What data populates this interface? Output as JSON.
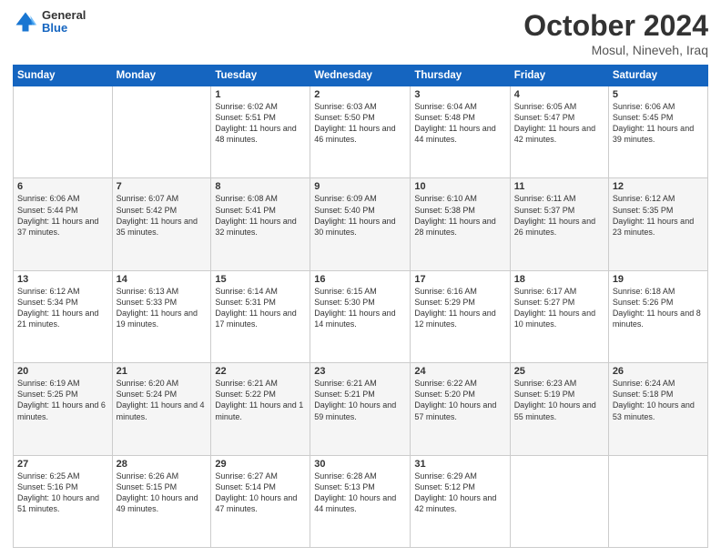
{
  "header": {
    "logo": {
      "general": "General",
      "blue": "Blue"
    },
    "title": "October 2024",
    "location": "Mosul, Nineveh, Iraq"
  },
  "calendar": {
    "headers": [
      "Sunday",
      "Monday",
      "Tuesday",
      "Wednesday",
      "Thursday",
      "Friday",
      "Saturday"
    ],
    "weeks": [
      [
        {
          "day": "",
          "info": ""
        },
        {
          "day": "",
          "info": ""
        },
        {
          "day": "1",
          "info": "Sunrise: 6:02 AM\nSunset: 5:51 PM\nDaylight: 11 hours and 48 minutes."
        },
        {
          "day": "2",
          "info": "Sunrise: 6:03 AM\nSunset: 5:50 PM\nDaylight: 11 hours and 46 minutes."
        },
        {
          "day": "3",
          "info": "Sunrise: 6:04 AM\nSunset: 5:48 PM\nDaylight: 11 hours and 44 minutes."
        },
        {
          "day": "4",
          "info": "Sunrise: 6:05 AM\nSunset: 5:47 PM\nDaylight: 11 hours and 42 minutes."
        },
        {
          "day": "5",
          "info": "Sunrise: 6:06 AM\nSunset: 5:45 PM\nDaylight: 11 hours and 39 minutes."
        }
      ],
      [
        {
          "day": "6",
          "info": "Sunrise: 6:06 AM\nSunset: 5:44 PM\nDaylight: 11 hours and 37 minutes."
        },
        {
          "day": "7",
          "info": "Sunrise: 6:07 AM\nSunset: 5:42 PM\nDaylight: 11 hours and 35 minutes."
        },
        {
          "day": "8",
          "info": "Sunrise: 6:08 AM\nSunset: 5:41 PM\nDaylight: 11 hours and 32 minutes."
        },
        {
          "day": "9",
          "info": "Sunrise: 6:09 AM\nSunset: 5:40 PM\nDaylight: 11 hours and 30 minutes."
        },
        {
          "day": "10",
          "info": "Sunrise: 6:10 AM\nSunset: 5:38 PM\nDaylight: 11 hours and 28 minutes."
        },
        {
          "day": "11",
          "info": "Sunrise: 6:11 AM\nSunset: 5:37 PM\nDaylight: 11 hours and 26 minutes."
        },
        {
          "day": "12",
          "info": "Sunrise: 6:12 AM\nSunset: 5:35 PM\nDaylight: 11 hours and 23 minutes."
        }
      ],
      [
        {
          "day": "13",
          "info": "Sunrise: 6:12 AM\nSunset: 5:34 PM\nDaylight: 11 hours and 21 minutes."
        },
        {
          "day": "14",
          "info": "Sunrise: 6:13 AM\nSunset: 5:33 PM\nDaylight: 11 hours and 19 minutes."
        },
        {
          "day": "15",
          "info": "Sunrise: 6:14 AM\nSunset: 5:31 PM\nDaylight: 11 hours and 17 minutes."
        },
        {
          "day": "16",
          "info": "Sunrise: 6:15 AM\nSunset: 5:30 PM\nDaylight: 11 hours and 14 minutes."
        },
        {
          "day": "17",
          "info": "Sunrise: 6:16 AM\nSunset: 5:29 PM\nDaylight: 11 hours and 12 minutes."
        },
        {
          "day": "18",
          "info": "Sunrise: 6:17 AM\nSunset: 5:27 PM\nDaylight: 11 hours and 10 minutes."
        },
        {
          "day": "19",
          "info": "Sunrise: 6:18 AM\nSunset: 5:26 PM\nDaylight: 11 hours and 8 minutes."
        }
      ],
      [
        {
          "day": "20",
          "info": "Sunrise: 6:19 AM\nSunset: 5:25 PM\nDaylight: 11 hours and 6 minutes."
        },
        {
          "day": "21",
          "info": "Sunrise: 6:20 AM\nSunset: 5:24 PM\nDaylight: 11 hours and 4 minutes."
        },
        {
          "day": "22",
          "info": "Sunrise: 6:21 AM\nSunset: 5:22 PM\nDaylight: 11 hours and 1 minute."
        },
        {
          "day": "23",
          "info": "Sunrise: 6:21 AM\nSunset: 5:21 PM\nDaylight: 10 hours and 59 minutes."
        },
        {
          "day": "24",
          "info": "Sunrise: 6:22 AM\nSunset: 5:20 PM\nDaylight: 10 hours and 57 minutes."
        },
        {
          "day": "25",
          "info": "Sunrise: 6:23 AM\nSunset: 5:19 PM\nDaylight: 10 hours and 55 minutes."
        },
        {
          "day": "26",
          "info": "Sunrise: 6:24 AM\nSunset: 5:18 PM\nDaylight: 10 hours and 53 minutes."
        }
      ],
      [
        {
          "day": "27",
          "info": "Sunrise: 6:25 AM\nSunset: 5:16 PM\nDaylight: 10 hours and 51 minutes."
        },
        {
          "day": "28",
          "info": "Sunrise: 6:26 AM\nSunset: 5:15 PM\nDaylight: 10 hours and 49 minutes."
        },
        {
          "day": "29",
          "info": "Sunrise: 6:27 AM\nSunset: 5:14 PM\nDaylight: 10 hours and 47 minutes."
        },
        {
          "day": "30",
          "info": "Sunrise: 6:28 AM\nSunset: 5:13 PM\nDaylight: 10 hours and 44 minutes."
        },
        {
          "day": "31",
          "info": "Sunrise: 6:29 AM\nSunset: 5:12 PM\nDaylight: 10 hours and 42 minutes."
        },
        {
          "day": "",
          "info": ""
        },
        {
          "day": "",
          "info": ""
        }
      ]
    ]
  }
}
